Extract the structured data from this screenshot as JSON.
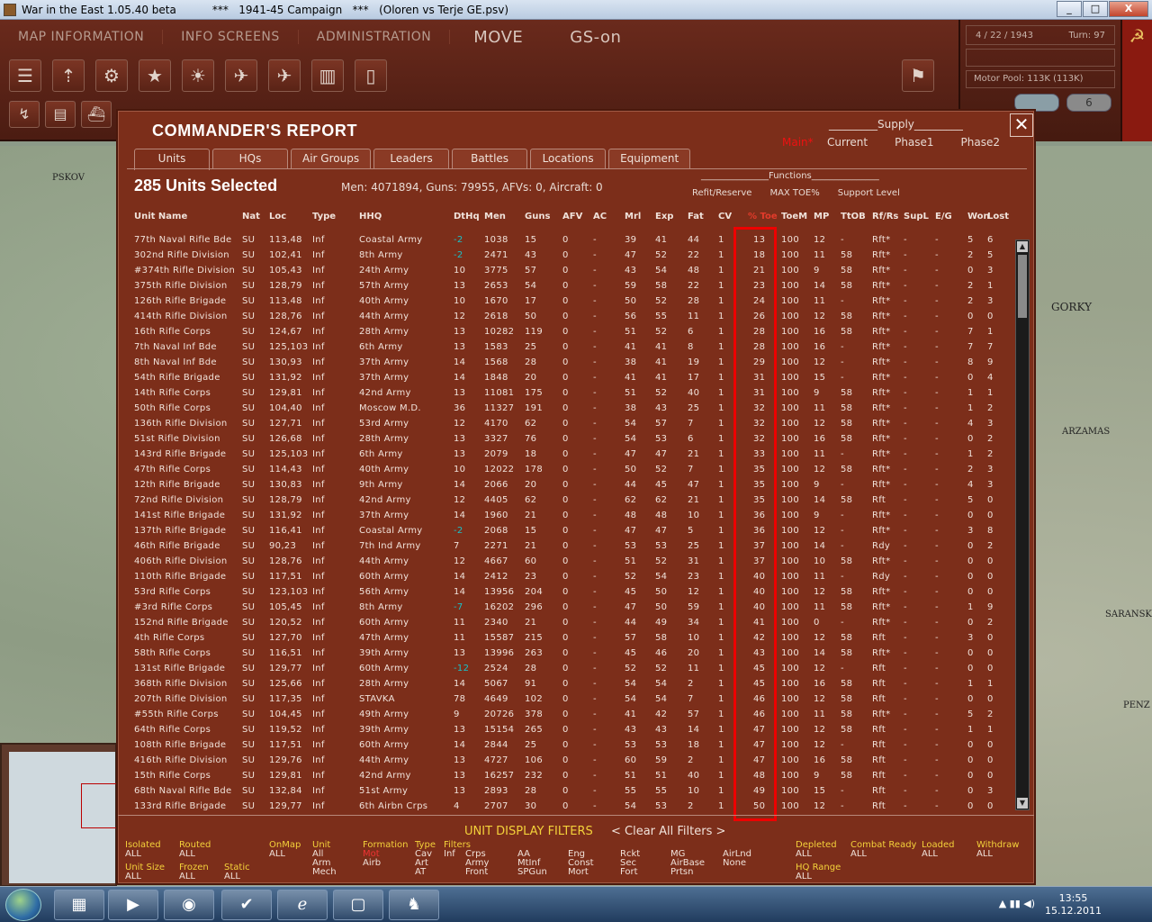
{
  "window": {
    "title": "War in the East 1.05.40 beta",
    "doc": "***   1941-45 Campaign   ***   (Oloren vs Terje GE.psv)",
    "min": "_",
    "max": "□",
    "close": "X"
  },
  "menu": {
    "map_info": "MAP INFORMATION",
    "info_screens": "INFO SCREENS",
    "administration": "ADMINISTRATION",
    "move": "MOVE",
    "gs_on": "GS-on"
  },
  "status": {
    "date": "4 / 22 / 1943",
    "turn": "Turn: 97",
    "motor_pool": "Motor Pool:  113K (113K)",
    "counter": "6"
  },
  "map_labels": {
    "pskov": "PSKOV",
    "gorky": "GORKY",
    "arzamas": "ARZAMAS",
    "saransk": "SARANSK",
    "penza": "PENZ"
  },
  "dialog": {
    "title": "COMMANDER'S REPORT",
    "close": "✕",
    "selected": "285 Units Selected",
    "totals": "Men: 4071894, Guns: 79955, AFVs: 0, Aircraft: 0",
    "supply_head": "_________Supply_________",
    "supply_main": "Main*",
    "supply_cols": [
      "Current",
      "Phase1",
      "Phase2"
    ],
    "functions_head": "_______________Functions_______________",
    "functions": [
      "Refit/Reserve",
      "MAX TOE%",
      "Support Level"
    ],
    "tabs": [
      "Units",
      "HQs",
      "Air Groups",
      "Leaders",
      "Battles",
      "Locations",
      "Equipment"
    ]
  },
  "columns": [
    "Unit Name",
    "Nat",
    "Loc",
    "Type",
    "HHQ",
    "DtHq",
    "Men",
    "Guns",
    "AFV",
    "AC",
    "Mrl",
    "Exp",
    "Fat",
    "CV",
    "% Toe",
    "ToeM",
    "MP",
    "TtOB",
    "Rf/Rs",
    "SupL",
    "E/G",
    "Won",
    "Lost"
  ],
  "rows": [
    [
      "77th Naval Rifle Bde",
      "SU",
      "113,48",
      "Inf",
      "Coastal Army",
      "-2",
      "1038",
      "15",
      "0",
      "-",
      "39",
      "41",
      "44",
      "1",
      "13",
      "100",
      "12",
      "-",
      "Rft*",
      "-",
      "-",
      "5",
      "6"
    ],
    [
      "302nd Rifle Division",
      "SU",
      "102,41",
      "Inf",
      "8th Army",
      "-2",
      "2471",
      "43",
      "0",
      "-",
      "47",
      "52",
      "22",
      "1",
      "18",
      "100",
      "11",
      "58",
      "Rft*",
      "-",
      "-",
      "2",
      "5"
    ],
    [
      "#374th Rifle Division",
      "SU",
      "105,43",
      "Inf",
      "24th Army",
      "10",
      "3775",
      "57",
      "0",
      "-",
      "43",
      "54",
      "48",
      "1",
      "21",
      "100",
      "9",
      "58",
      "Rft*",
      "-",
      "-",
      "0",
      "3"
    ],
    [
      "375th Rifle Division",
      "SU",
      "128,79",
      "Inf",
      "57th Army",
      "13",
      "2653",
      "54",
      "0",
      "-",
      "59",
      "58",
      "22",
      "1",
      "23",
      "100",
      "14",
      "58",
      "Rft*",
      "-",
      "-",
      "2",
      "1"
    ],
    [
      "126th Rifle Brigade",
      "SU",
      "113,48",
      "Inf",
      "40th Army",
      "10",
      "1670",
      "17",
      "0",
      "-",
      "50",
      "52",
      "28",
      "1",
      "24",
      "100",
      "11",
      "-",
      "Rft*",
      "-",
      "-",
      "2",
      "3"
    ],
    [
      "414th Rifle Division",
      "SU",
      "128,76",
      "Inf",
      "44th Army",
      "12",
      "2618",
      "50",
      "0",
      "-",
      "56",
      "55",
      "11",
      "1",
      "26",
      "100",
      "12",
      "58",
      "Rft*",
      "-",
      "-",
      "0",
      "0"
    ],
    [
      "16th Rifle Corps",
      "SU",
      "124,67",
      "Inf",
      "28th Army",
      "13",
      "10282",
      "119",
      "0",
      "-",
      "51",
      "52",
      "6",
      "1",
      "28",
      "100",
      "16",
      "58",
      "Rft*",
      "-",
      "-",
      "7",
      "1"
    ],
    [
      "7th Naval Inf Bde",
      "SU",
      "125,103",
      "Inf",
      "6th Army",
      "13",
      "1583",
      "25",
      "0",
      "-",
      "41",
      "41",
      "8",
      "1",
      "28",
      "100",
      "16",
      "-",
      "Rft*",
      "-",
      "-",
      "7",
      "7"
    ],
    [
      "8th Naval Inf Bde",
      "SU",
      "130,93",
      "Inf",
      "37th Army",
      "14",
      "1568",
      "28",
      "0",
      "-",
      "38",
      "41",
      "19",
      "1",
      "29",
      "100",
      "12",
      "-",
      "Rft*",
      "-",
      "-",
      "8",
      "9"
    ],
    [
      "54th Rifle Brigade",
      "SU",
      "131,92",
      "Inf",
      "37th Army",
      "14",
      "1848",
      "20",
      "0",
      "-",
      "41",
      "41",
      "17",
      "1",
      "31",
      "100",
      "15",
      "-",
      "Rft*",
      "-",
      "-",
      "0",
      "4"
    ],
    [
      "14th Rifle Corps",
      "SU",
      "129,81",
      "Inf",
      "42nd Army",
      "13",
      "11081",
      "175",
      "0",
      "-",
      "51",
      "52",
      "40",
      "1",
      "31",
      "100",
      "9",
      "58",
      "Rft*",
      "-",
      "-",
      "1",
      "1"
    ],
    [
      "50th Rifle Corps",
      "SU",
      "104,40",
      "Inf",
      "Moscow M.D.",
      "36",
      "11327",
      "191",
      "0",
      "-",
      "38",
      "43",
      "25",
      "1",
      "32",
      "100",
      "11",
      "58",
      "Rft*",
      "-",
      "-",
      "1",
      "2"
    ],
    [
      "136th Rifle Division",
      "SU",
      "127,71",
      "Inf",
      "53rd Army",
      "12",
      "4170",
      "62",
      "0",
      "-",
      "54",
      "57",
      "7",
      "1",
      "32",
      "100",
      "12",
      "58",
      "Rft*",
      "-",
      "-",
      "4",
      "3"
    ],
    [
      "51st Rifle Division",
      "SU",
      "126,68",
      "Inf",
      "28th Army",
      "13",
      "3327",
      "76",
      "0",
      "-",
      "54",
      "53",
      "6",
      "1",
      "32",
      "100",
      "16",
      "58",
      "Rft*",
      "-",
      "-",
      "0",
      "2"
    ],
    [
      "143rd Rifle Brigade",
      "SU",
      "125,103",
      "Inf",
      "6th Army",
      "13",
      "2079",
      "18",
      "0",
      "-",
      "47",
      "47",
      "21",
      "1",
      "33",
      "100",
      "11",
      "-",
      "Rft*",
      "-",
      "-",
      "1",
      "2"
    ],
    [
      "47th Rifle Corps",
      "SU",
      "114,43",
      "Inf",
      "40th Army",
      "10",
      "12022",
      "178",
      "0",
      "-",
      "50",
      "52",
      "7",
      "1",
      "35",
      "100",
      "12",
      "58",
      "Rft*",
      "-",
      "-",
      "2",
      "3"
    ],
    [
      "12th Rifle Brigade",
      "SU",
      "130,83",
      "Inf",
      "9th Army",
      "14",
      "2066",
      "20",
      "0",
      "-",
      "44",
      "45",
      "47",
      "1",
      "35",
      "100",
      "9",
      "-",
      "Rft*",
      "-",
      "-",
      "4",
      "3"
    ],
    [
      "72nd Rifle Division",
      "SU",
      "128,79",
      "Inf",
      "42nd Army",
      "12",
      "4405",
      "62",
      "0",
      "-",
      "62",
      "62",
      "21",
      "1",
      "35",
      "100",
      "14",
      "58",
      "Rft",
      "-",
      "-",
      "5",
      "0"
    ],
    [
      "141st Rifle Brigade",
      "SU",
      "131,92",
      "Inf",
      "37th Army",
      "14",
      "1960",
      "21",
      "0",
      "-",
      "48",
      "48",
      "10",
      "1",
      "36",
      "100",
      "9",
      "-",
      "Rft*",
      "-",
      "-",
      "0",
      "0"
    ],
    [
      "137th Rifle Brigade",
      "SU",
      "116,41",
      "Inf",
      "Coastal Army",
      "-2",
      "2068",
      "15",
      "0",
      "-",
      "47",
      "47",
      "5",
      "1",
      "36",
      "100",
      "12",
      "-",
      "Rft*",
      "-",
      "-",
      "3",
      "8"
    ],
    [
      "46th Rifle Brigade",
      "SU",
      "90,23",
      "Inf",
      "7th Ind Army",
      "7",
      "2271",
      "21",
      "0",
      "-",
      "53",
      "53",
      "25",
      "1",
      "37",
      "100",
      "14",
      "-",
      "Rdy",
      "-",
      "-",
      "0",
      "2"
    ],
    [
      "406th Rifle Division",
      "SU",
      "128,76",
      "Inf",
      "44th Army",
      "12",
      "4667",
      "60",
      "0",
      "-",
      "51",
      "52",
      "31",
      "1",
      "37",
      "100",
      "10",
      "58",
      "Rft*",
      "-",
      "-",
      "0",
      "0"
    ],
    [
      "110th Rifle Brigade",
      "SU",
      "117,51",
      "Inf",
      "60th Army",
      "14",
      "2412",
      "23",
      "0",
      "-",
      "52",
      "54",
      "23",
      "1",
      "40",
      "100",
      "11",
      "-",
      "Rdy",
      "-",
      "-",
      "0",
      "0"
    ],
    [
      "53rd Rifle Corps",
      "SU",
      "123,103",
      "Inf",
      "56th Army",
      "14",
      "13956",
      "204",
      "0",
      "-",
      "45",
      "50",
      "12",
      "1",
      "40",
      "100",
      "12",
      "58",
      "Rft*",
      "-",
      "-",
      "0",
      "0"
    ],
    [
      "#3rd Rifle Corps",
      "SU",
      "105,45",
      "Inf",
      "8th Army",
      "-7",
      "16202",
      "296",
      "0",
      "-",
      "47",
      "50",
      "59",
      "1",
      "40",
      "100",
      "11",
      "58",
      "Rft*",
      "-",
      "-",
      "1",
      "9"
    ],
    [
      "152nd Rifle Brigade",
      "SU",
      "120,52",
      "Inf",
      "60th Army",
      "11",
      "2340",
      "21",
      "0",
      "-",
      "44",
      "49",
      "34",
      "1",
      "41",
      "100",
      "0",
      "-",
      "Rft*",
      "-",
      "-",
      "0",
      "2"
    ],
    [
      "4th Rifle Corps",
      "SU",
      "127,70",
      "Inf",
      "47th Army",
      "11",
      "15587",
      "215",
      "0",
      "-",
      "57",
      "58",
      "10",
      "1",
      "42",
      "100",
      "12",
      "58",
      "Rft",
      "-",
      "-",
      "3",
      "0"
    ],
    [
      "58th Rifle Corps",
      "SU",
      "116,51",
      "Inf",
      "39th Army",
      "13",
      "13996",
      "263",
      "0",
      "-",
      "45",
      "46",
      "20",
      "1",
      "43",
      "100",
      "14",
      "58",
      "Rft*",
      "-",
      "-",
      "0",
      "0"
    ],
    [
      "131st Rifle Brigade",
      "SU",
      "129,77",
      "Inf",
      "60th Army",
      "-12",
      "2524",
      "28",
      "0",
      "-",
      "52",
      "52",
      "11",
      "1",
      "45",
      "100",
      "12",
      "-",
      "Rft",
      "-",
      "-",
      "0",
      "0"
    ],
    [
      "368th Rifle Division",
      "SU",
      "125,66",
      "Inf",
      "28th Army",
      "14",
      "5067",
      "91",
      "0",
      "-",
      "54",
      "54",
      "2",
      "1",
      "45",
      "100",
      "16",
      "58",
      "Rft",
      "-",
      "-",
      "1",
      "1"
    ],
    [
      "207th Rifle Division",
      "SU",
      "117,35",
      "Inf",
      "STAVKA",
      "78",
      "4649",
      "102",
      "0",
      "-",
      "54",
      "54",
      "7",
      "1",
      "46",
      "100",
      "12",
      "58",
      "Rft",
      "-",
      "-",
      "0",
      "0"
    ],
    [
      "#55th Rifle Corps",
      "SU",
      "104,45",
      "Inf",
      "49th Army",
      "9",
      "20726",
      "378",
      "0",
      "-",
      "41",
      "42",
      "57",
      "1",
      "46",
      "100",
      "11",
      "58",
      "Rft*",
      "-",
      "-",
      "5",
      "2"
    ],
    [
      "64th Rifle Corps",
      "SU",
      "119,52",
      "Inf",
      "39th Army",
      "13",
      "15154",
      "265",
      "0",
      "-",
      "43",
      "43",
      "14",
      "1",
      "47",
      "100",
      "12",
      "58",
      "Rft",
      "-",
      "-",
      "1",
      "1"
    ],
    [
      "108th Rifle Brigade",
      "SU",
      "117,51",
      "Inf",
      "60th Army",
      "14",
      "2844",
      "25",
      "0",
      "-",
      "53",
      "53",
      "18",
      "1",
      "47",
      "100",
      "12",
      "-",
      "Rft",
      "-",
      "-",
      "0",
      "0"
    ],
    [
      "416th Rifle Division",
      "SU",
      "129,76",
      "Inf",
      "44th Army",
      "13",
      "4727",
      "106",
      "0",
      "-",
      "60",
      "59",
      "2",
      "1",
      "47",
      "100",
      "16",
      "58",
      "Rft",
      "-",
      "-",
      "0",
      "0"
    ],
    [
      "15th Rifle Corps",
      "SU",
      "129,81",
      "Inf",
      "42nd Army",
      "13",
      "16257",
      "232",
      "0",
      "-",
      "51",
      "51",
      "40",
      "1",
      "48",
      "100",
      "9",
      "58",
      "Rft",
      "-",
      "-",
      "0",
      "0"
    ],
    [
      "68th Naval Rifle Bde",
      "SU",
      "132,84",
      "Inf",
      "51st Army",
      "13",
      "2893",
      "28",
      "0",
      "-",
      "55",
      "55",
      "10",
      "1",
      "49",
      "100",
      "15",
      "-",
      "Rft",
      "-",
      "-",
      "0",
      "3"
    ],
    [
      "133rd Rifle Brigade",
      "SU",
      "129,77",
      "Inf",
      "6th Airbn Crps",
      "4",
      "2707",
      "30",
      "0",
      "-",
      "54",
      "53",
      "2",
      "1",
      "50",
      "100",
      "12",
      "-",
      "Rft",
      "-",
      "-",
      "0",
      "0"
    ]
  ],
  "filters": {
    "title": "UNIT DISPLAY FILTERS",
    "clear": "< Clear All Filters >",
    "groups": [
      {
        "h": "Isolated",
        "v": [
          "ALL"
        ]
      },
      {
        "h": "Routed",
        "v": [
          "ALL"
        ]
      },
      {
        "h": "Unit Size",
        "v": [
          "ALL"
        ]
      },
      {
        "h": "Frozen",
        "v": [
          "ALL"
        ]
      },
      {
        "h": "Static",
        "v": [
          "ALL"
        ]
      },
      {
        "h": "OnMap",
        "v": [
          "ALL"
        ]
      },
      {
        "h": "Unit",
        "v": [
          "All",
          "Arm",
          "Mech"
        ]
      },
      {
        "h": "Formation",
        "v": [
          "Mot",
          "Airb"
        ]
      },
      {
        "h": "Type",
        "v": [
          "Cav",
          "Art",
          "AT"
        ]
      },
      {
        "h": "Filters",
        "v": [
          "Inf"
        ]
      },
      {
        "h": "",
        "v": [
          "Crps",
          "Army",
          "Front"
        ]
      },
      {
        "h": "",
        "v": [
          "AA",
          "MtInf",
          "SPGun"
        ]
      },
      {
        "h": "",
        "v": [
          "Eng",
          "Const",
          "Mort"
        ]
      },
      {
        "h": "",
        "v": [
          "Rckt",
          "Sec",
          "Fort"
        ]
      },
      {
        "h": "",
        "v": [
          "MG",
          "AirBase",
          "Prtsn"
        ]
      },
      {
        "h": "",
        "v": [
          "AirLnd",
          "None"
        ]
      },
      {
        "h": "Depleted",
        "v": [
          "ALL"
        ]
      },
      {
        "h": "HQ Range",
        "v": [
          "ALL"
        ]
      },
      {
        "h": "Combat Ready",
        "v": [
          "ALL"
        ]
      },
      {
        "h": "Loaded",
        "v": [
          "ALL"
        ]
      },
      {
        "h": "Withdraw",
        "v": [
          "ALL"
        ]
      }
    ]
  },
  "taskbar": {
    "time": "13:55",
    "date": "15.12.2011"
  }
}
